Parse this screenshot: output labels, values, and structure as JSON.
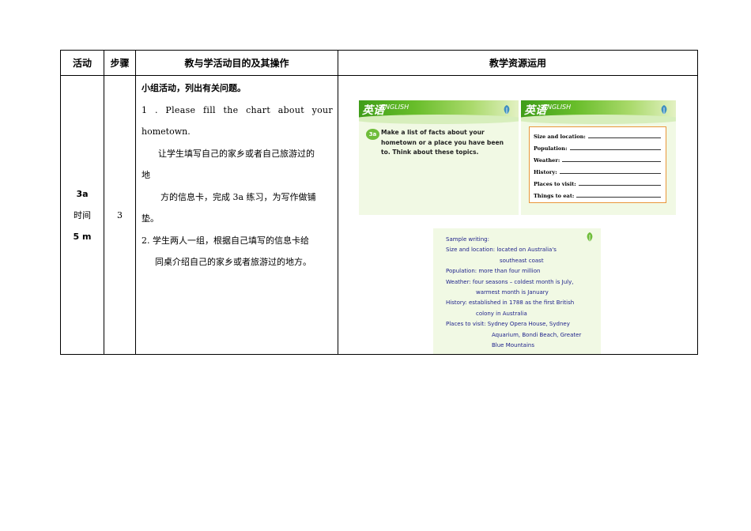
{
  "table": {
    "headers": [
      "活动",
      "步骤",
      "教与学活动目的及其操作",
      "教学资源运用"
    ],
    "activity": {
      "code": "3a",
      "time_label": "时间",
      "duration": "5 m"
    },
    "step": "3",
    "content": {
      "title": "小组活动，列出有关问题。",
      "line1": "1 . Please fill the chart about your",
      "line2": "hometown.",
      "line3": "让学生填写自己的家乡或者自己旅游过的",
      "line4": "地",
      "line5": "方的信息卡，完成 3a 练习，为写作做铺",
      "line6": "垫。",
      "line7": "2. 学生两人一组，根据自己填写的信息卡给",
      "line8": "同桌介绍自己的家乡或者旅游过的地方。"
    }
  },
  "slides": {
    "logo": "英语",
    "logo_sub": "ENGLISH",
    "s1": {
      "badge": "3a",
      "text": "Make a list of facts about your hometown or a place you have been to. Think about these topics."
    },
    "s2": {
      "rows": [
        "Size and location:",
        "Population:",
        "Weather:",
        "History:",
        "Places to visit:",
        "Things to eat:"
      ]
    },
    "s3": {
      "lines": [
        "Sample writing:",
        "Size and location: located on Australia's",
        "southeast coast",
        "Population: more than four million",
        "Weather: four seasons – coldest month is July,",
        "warmest month is January",
        "History: established in 1788 as the first British",
        "colony in Australia",
        "Places to visit: Sydney Opera House, Sydney",
        "Aquarium, Bondi Beach, Greater",
        "Blue Mountains"
      ]
    }
  },
  "colors": {
    "green": "#6fbd3a",
    "orange": "#e9963a",
    "navy": "#1c1f8a"
  }
}
